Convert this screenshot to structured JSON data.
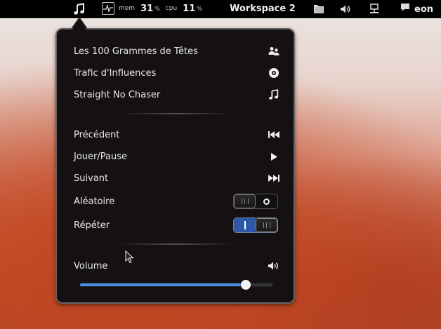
{
  "panel": {
    "music_icon": "music-note-icon",
    "sysmon": {
      "mem_label": "mem",
      "mem_value": "31",
      "mem_unit": "%",
      "cpu_label": "cpu",
      "cpu_value": "11",
      "cpu_unit": "%"
    },
    "workspace_label": "Workspace 2",
    "user_name": "eon"
  },
  "menu": {
    "track": {
      "artist": "Les 100 Grammes de Têtes",
      "album": "Trafic d'Influences",
      "title": "Straight No Chaser"
    },
    "controls": {
      "previous": "Précédent",
      "play_pause": "Jouer/Pause",
      "next": "Suivant"
    },
    "shuffle": {
      "label": "Aléatoire",
      "state": "off"
    },
    "repeat": {
      "label": "Répéter",
      "state": "on"
    },
    "volume": {
      "label": "Volume",
      "level": 0.86
    }
  },
  "colors": {
    "accent": "#4a90e2",
    "switch_on": "#2d59a8",
    "menu_bg": "#151112"
  }
}
